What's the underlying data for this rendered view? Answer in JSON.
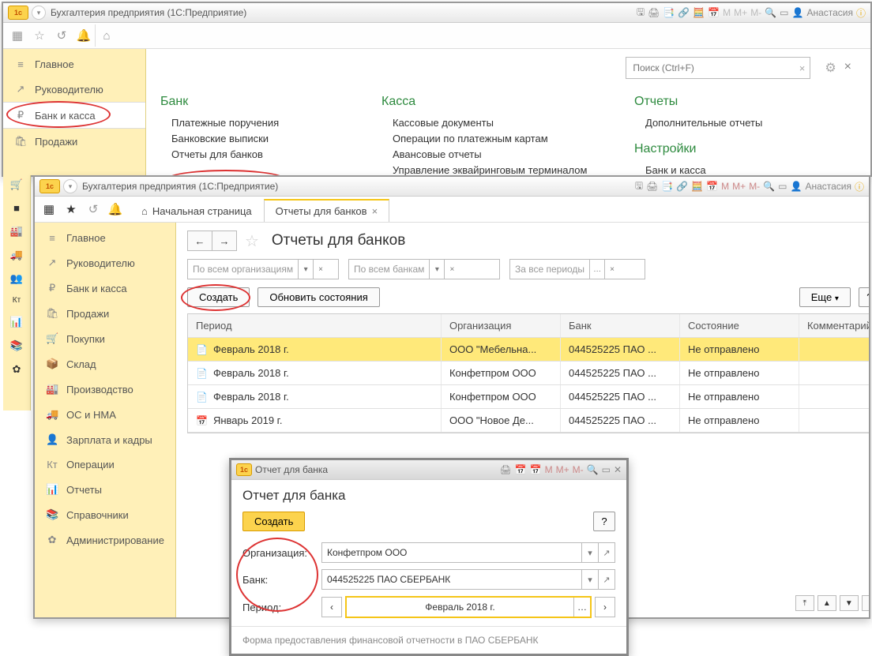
{
  "win1": {
    "app_title": "Бухгалтерия предприятия   (1С:Предприятие)",
    "user": "Анастасия",
    "search_placeholder": "Поиск (Ctrl+F)",
    "sidebar": [
      {
        "icon": "≡",
        "label": "Главное"
      },
      {
        "icon": "↗",
        "label": "Руководителю"
      },
      {
        "icon": "₽",
        "label": "Банк и касса",
        "active": true,
        "circled": true
      },
      {
        "icon": "🛍",
        "label": "Продажи"
      }
    ],
    "icon_strip": [
      "🛒",
      "■",
      "🏭",
      "🚚",
      "👥",
      "Кт",
      "📊",
      "📚",
      "✿"
    ],
    "cols": {
      "bank": {
        "title": "Банк",
        "items": [
          "Платежные поручения",
          "Банковские выписки",
          "Отчеты для банков"
        ]
      },
      "kassa": {
        "title": "Касса",
        "items": [
          "Кассовые документы",
          "Операции по платежным картам",
          "Авансовые отчеты",
          "Управление эквайринговым терминалом"
        ]
      },
      "otchety": {
        "title": "Отчеты",
        "items": [
          "Дополнительные отчеты"
        ]
      },
      "nastr": {
        "title": "Настройки",
        "items": [
          "Банк и касса"
        ]
      }
    }
  },
  "win2": {
    "app_title": "Бухгалтерия предприятия   (1С:Предприятие)",
    "user": "Анастасия",
    "tabs": [
      {
        "icon": "⌂",
        "label": "Начальная страница"
      },
      {
        "label": "Отчеты для банков",
        "close": true,
        "active": true
      }
    ],
    "page_title": "Отчеты для банков",
    "filters": {
      "org": "По всем организациям",
      "bank": "По всем банкам",
      "period": "За все периоды"
    },
    "buttons": {
      "create": "Создать",
      "refresh": "Обновить состояния",
      "more": "Еще",
      "help": "?"
    },
    "table": {
      "headers": {
        "period": "Период",
        "org": "Организация",
        "bank": "Банк",
        "status": "Состояние",
        "comment": "Комментарий"
      },
      "rows": [
        {
          "icon": "📄",
          "period": "Февраль 2018 г.",
          "org": "ООО \"Мебельна...",
          "bank": "044525225 ПАО ...",
          "status": "Не отправлено",
          "selected": true
        },
        {
          "icon": "📄",
          "period": "Февраль 2018 г.",
          "org": "Конфетпром ООО",
          "bank": "044525225 ПАО ...",
          "status": "Не отправлено"
        },
        {
          "icon": "📄",
          "period": "Февраль 2018 г.",
          "org": "Конфетпром ООО",
          "bank": "044525225 ПАО ...",
          "status": "Не отправлено"
        },
        {
          "icon": "📅",
          "period": "Январь 2019 г.",
          "org": "ООО \"Новое Де...",
          "bank": "044525225 ПАО ...",
          "status": "Не отправлено"
        }
      ]
    },
    "sidebar": [
      {
        "icon": "≡",
        "label": "Главное"
      },
      {
        "icon": "↗",
        "label": "Руководителю"
      },
      {
        "icon": "₽",
        "label": "Банк и касса"
      },
      {
        "icon": "🛍",
        "label": "Продажи"
      },
      {
        "icon": "🛒",
        "label": "Покупки"
      },
      {
        "icon": "📦",
        "label": "Склад"
      },
      {
        "icon": "🏭",
        "label": "Производство"
      },
      {
        "icon": "🚚",
        "label": "ОС и НМА"
      },
      {
        "icon": "👤",
        "label": "Зарплата и кадры"
      },
      {
        "icon": "Кт",
        "label": "Операции"
      },
      {
        "icon": "📊",
        "label": "Отчеты"
      },
      {
        "icon": "📚",
        "label": "Справочники"
      },
      {
        "icon": "✿",
        "label": "Администрирование"
      }
    ]
  },
  "dialog": {
    "title": "Отчет для банка",
    "page_title": "Отчет для банка",
    "create": "Создать",
    "help": "?",
    "org_label": "Организация:",
    "org_value": "Конфетпром ООО",
    "bank_label": "Банк:",
    "bank_value": "044525225 ПАО СБЕРБАНК",
    "period_label": "Период:",
    "period_value": "Февраль 2018 г.",
    "footer": "Форма предоставления финансовой отчетности в ПАО СБЕРБАНК"
  }
}
